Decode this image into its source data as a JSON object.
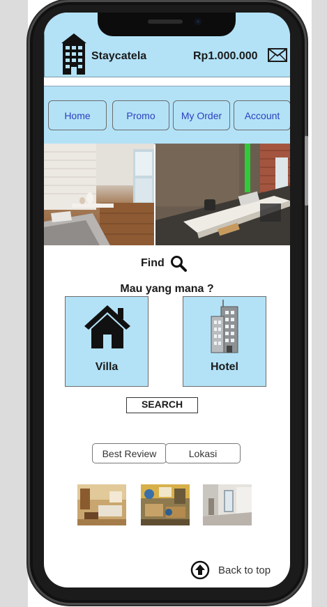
{
  "header": {
    "app_name": "Staycatela",
    "balance": "Rp1.000.000",
    "logo_icon": "building-icon",
    "mail_icon": "mail-icon"
  },
  "nav": {
    "items": [
      {
        "label": "Home"
      },
      {
        "label": "Promo"
      },
      {
        "label": "My Order"
      },
      {
        "label": "Account"
      }
    ]
  },
  "hero": {
    "images": [
      "bedroom-photo",
      "desk-room-photo"
    ]
  },
  "find": {
    "label": "Find",
    "icon": "search-icon"
  },
  "question": "Mau yang mana ?",
  "types": [
    {
      "label": "Villa",
      "icon": "house-icon"
    },
    {
      "label": "Hotel",
      "icon": "hotel-building-icon"
    }
  ],
  "search_button": "SEARCH",
  "tabs": [
    {
      "label": "Best Review"
    },
    {
      "label": "Lokasi"
    }
  ],
  "thumbnails": [
    "room-thumbnail-1",
    "room-thumbnail-2",
    "room-thumbnail-3"
  ],
  "back_to_top": {
    "label": "Back to top",
    "icon": "arrow-up-circle-icon"
  },
  "colors": {
    "accent": "#b3e2f7",
    "nav_text": "#2b3fbf",
    "frame": "#1b1b1b"
  }
}
